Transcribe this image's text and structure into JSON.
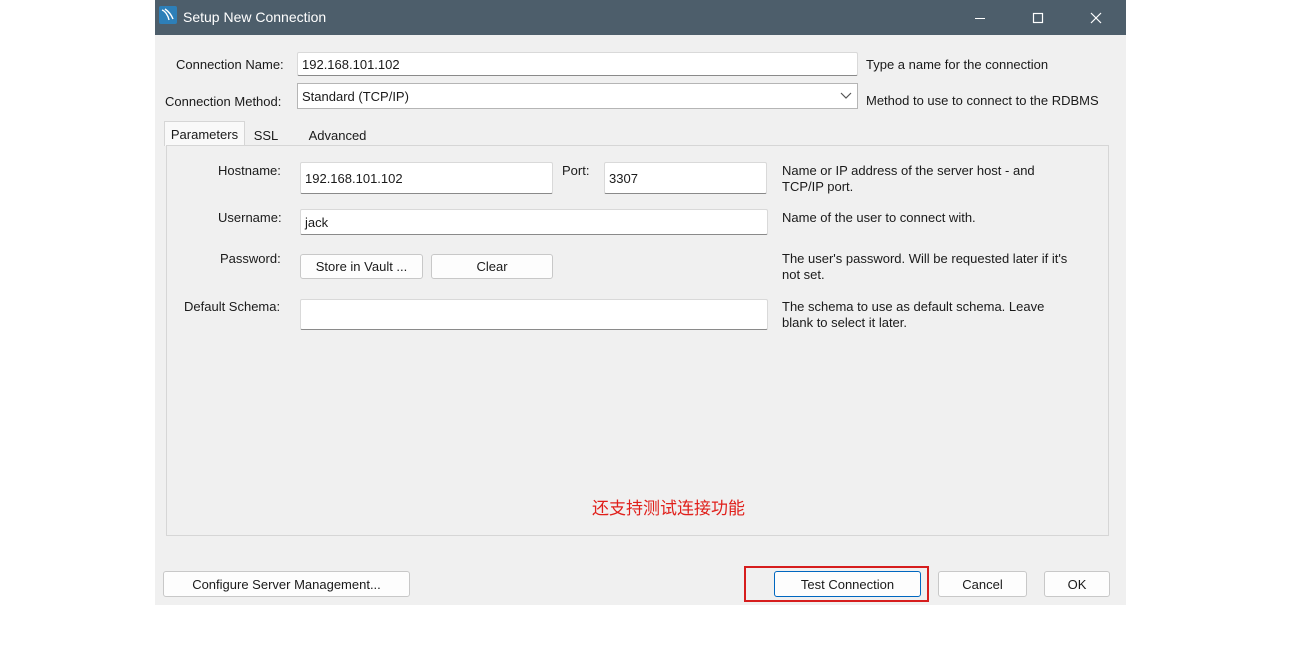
{
  "window": {
    "title": "Setup New Connection",
    "controls": {
      "minimize": "minimize-icon",
      "maximize": "maximize-icon",
      "close": "close-icon"
    }
  },
  "connection": {
    "name_label": "Connection Name:",
    "name_value": "192.168.101.102",
    "name_hint": "Type a name for the connection",
    "method_label": "Connection Method:",
    "method_value": "Standard (TCP/IP)",
    "method_hint": "Method to use to connect to the RDBMS"
  },
  "tabs": [
    {
      "label": "Parameters",
      "active": true
    },
    {
      "label": "SSL",
      "active": false
    },
    {
      "label": "Advanced",
      "active": false
    }
  ],
  "parameters": {
    "hostname_label": "Hostname:",
    "hostname_value": "192.168.101.102",
    "port_label": "Port:",
    "port_value": "3307",
    "host_hint_line1": "Name or IP address of the server host - and",
    "host_hint_line2": "TCP/IP port.",
    "username_label": "Username:",
    "username_value": "jack",
    "username_hint": "Name of the user to connect with.",
    "password_label": "Password:",
    "store_vault_label": "Store in Vault ...",
    "clear_label": "Clear",
    "password_hint_line1": "The user's password. Will be requested later if it's",
    "password_hint_line2": "not set.",
    "schema_label": "Default Schema:",
    "schema_value": "",
    "schema_hint_line1": "The schema to use as default schema. Leave",
    "schema_hint_line2": "blank to select it later."
  },
  "annotation": {
    "text": "还支持测试连接功能",
    "color": "#e0201b"
  },
  "footer": {
    "configure_label": "Configure Server Management...",
    "test_label": "Test Connection",
    "cancel_label": "Cancel",
    "ok_label": "OK"
  },
  "colors": {
    "titlebar": "#4d5e6b",
    "dialog_bg": "#f0f0f0",
    "highlight_border": "#d61d1d",
    "focus_border": "#0067c0"
  }
}
